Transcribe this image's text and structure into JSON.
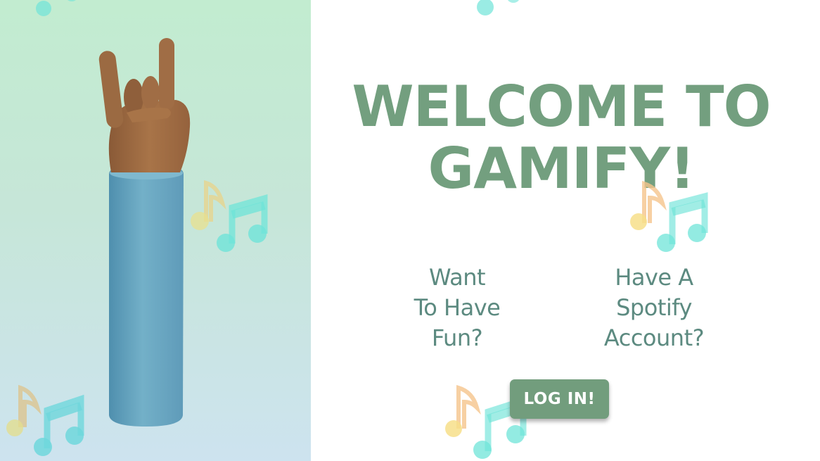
{
  "hero": {
    "title_line1": "WELCOME TO",
    "title_line2": "GAMIFY!"
  },
  "questions": [
    {
      "lines": [
        "Want",
        "To Have",
        "Fun?"
      ]
    },
    {
      "lines": [
        "Have A",
        "Spotify",
        "Account?"
      ]
    }
  ],
  "login": {
    "label": "LOG IN!"
  },
  "colors": {
    "accent": "#729d7d",
    "title": "#739f7f",
    "question_text": "#5c8a80",
    "left_panel_top": "#c2ecd0",
    "left_panel_bottom": "#cde3ef",
    "note_yellow": "#f7df8a",
    "note_orange": "#f5c48c",
    "note_teal": "#6fe4d8"
  },
  "icons": {
    "hand": "rock-on-hand-icon",
    "music_notes": "music-notes-icon"
  }
}
